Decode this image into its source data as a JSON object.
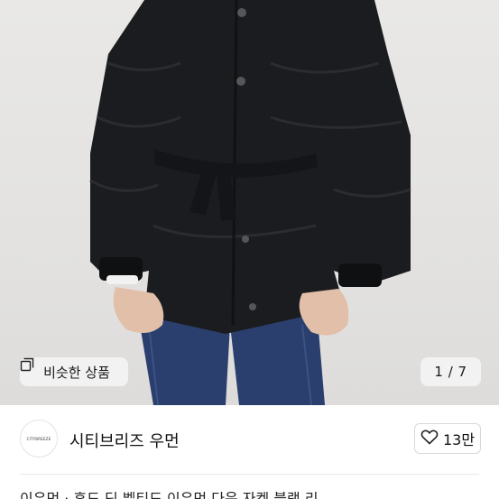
{
  "product_image": {
    "similar_button_label": "비슷한 상품",
    "counter": "1 / 7"
  },
  "seller": {
    "name": "시티브리즈 우먼",
    "avatar_text": "CITYBREEZE"
  },
  "like": {
    "count": "13만"
  },
  "description_partial": "이우먼 · 후드 딘 벨티드 이우먼 다운 자켓 블랙 리"
}
